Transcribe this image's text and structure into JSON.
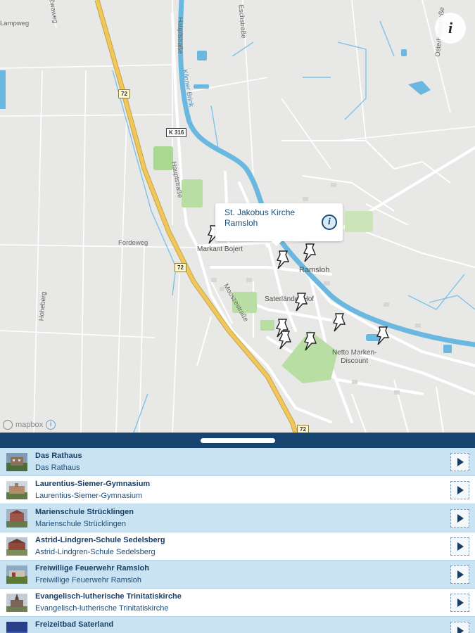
{
  "map": {
    "street_labels": [
      "Hauptstraße",
      "Eschstraße",
      "Hauptstraße",
      "Fordeweg",
      "Mooszestraße",
      "Hoheberg",
      "Osterhausstraße",
      "Zwaweg",
      "Lampweg",
      "Klinner Brink"
    ],
    "road_shields": [
      "72",
      "K 316",
      "72",
      "72"
    ],
    "poi_labels": [
      "Markant Bojert",
      "Ramsloh",
      "Saterländer Hof",
      "Netto Marken-\nDiscount"
    ],
    "callout": {
      "title": "St. Jakobus Kirche Ramsloh",
      "info_glyph": "i"
    },
    "info_button_glyph": "i",
    "attribution": "mapbox",
    "attribution_info_glyph": "i",
    "colors": {
      "water": "#6ab8e0",
      "green": "#b9dea4",
      "highway": "#f0c75a"
    }
  },
  "list": {
    "items": [
      {
        "title": "Das Rathaus",
        "subtitle": "Das Rathaus"
      },
      {
        "title": "Laurentius-Siemer-Gymnasium",
        "subtitle": "Laurentius-Siemer-Gymnasium"
      },
      {
        "title": "Marienschule Strücklingen",
        "subtitle": "Marienschule Strücklingen"
      },
      {
        "title": "Astrid-Lindgren-Schule Sedelsberg",
        "subtitle": "Astrid-Lindgren-Schule Sedelsberg"
      },
      {
        "title": "Freiwillige Feuerwehr Ramsloh",
        "subtitle": "Freiwillige Feuerwehr Ramsloh"
      },
      {
        "title": "Evangelisch-lutherische Trinitatiskirche",
        "subtitle": "Evangelisch-lutherische Trinitatiskirche"
      },
      {
        "title": "Freizeitbad Saterland",
        "subtitle": ""
      }
    ]
  },
  "colors": {
    "header_bar": "#17456f",
    "row_alt": "#c9e3f3",
    "text_primary": "#1b3e66"
  }
}
